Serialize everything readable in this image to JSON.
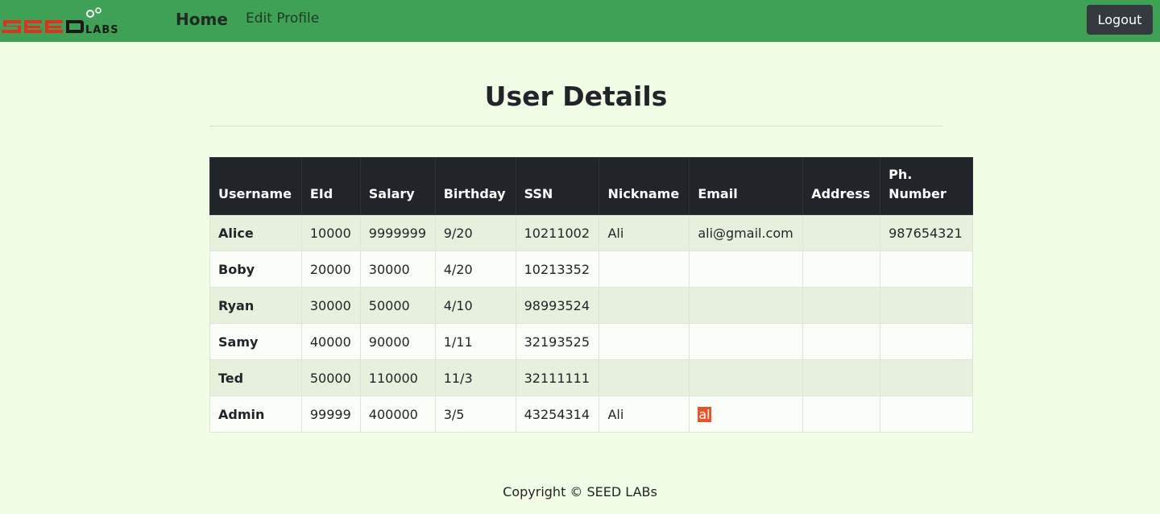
{
  "nav": {
    "logo_text": "SEED LABS",
    "home_label": "Home",
    "edit_profile_label": "Edit Profile",
    "logout_label": "Logout"
  },
  "page": {
    "title": "User Details"
  },
  "table": {
    "headers": [
      "Username",
      "EId",
      "Salary",
      "Birthday",
      "SSN",
      "Nickname",
      "Email",
      "Address",
      "Ph. Number"
    ],
    "rows": [
      {
        "username": "Alice",
        "eid": "10000",
        "salary": "9999999",
        "birthday": "9/20",
        "ssn": "10211002",
        "nickname": "Ali",
        "email": "ali@gmail.com",
        "address": "",
        "phone": "987654321"
      },
      {
        "username": "Boby",
        "eid": "20000",
        "salary": "30000",
        "birthday": "4/20",
        "ssn": "10213352",
        "nickname": "",
        "email": "",
        "address": "",
        "phone": ""
      },
      {
        "username": "Ryan",
        "eid": "30000",
        "salary": "50000",
        "birthday": "4/10",
        "ssn": "98993524",
        "nickname": "",
        "email": "",
        "address": "",
        "phone": ""
      },
      {
        "username": "Samy",
        "eid": "40000",
        "salary": "90000",
        "birthday": "1/11",
        "ssn": "32193525",
        "nickname": "",
        "email": "",
        "address": "",
        "phone": ""
      },
      {
        "username": "Ted",
        "eid": "50000",
        "salary": "110000",
        "birthday": "11/3",
        "ssn": "32111111",
        "nickname": "",
        "email": "",
        "address": "",
        "phone": ""
      },
      {
        "username": "Admin",
        "eid": "99999",
        "salary": "400000",
        "birthday": "3/5",
        "ssn": "43254314",
        "nickname": "Ali",
        "email": "al",
        "address": "",
        "phone": ""
      }
    ]
  },
  "footer": {
    "copyright": "Copyright © SEED LABs"
  },
  "colors": {
    "navbar": "#3ea155",
    "page_background": "#f1fde5",
    "table_header": "#212529",
    "logout_button": "#343a40",
    "logo_red": "#e0301e",
    "text_highlight": "#e8532c"
  }
}
